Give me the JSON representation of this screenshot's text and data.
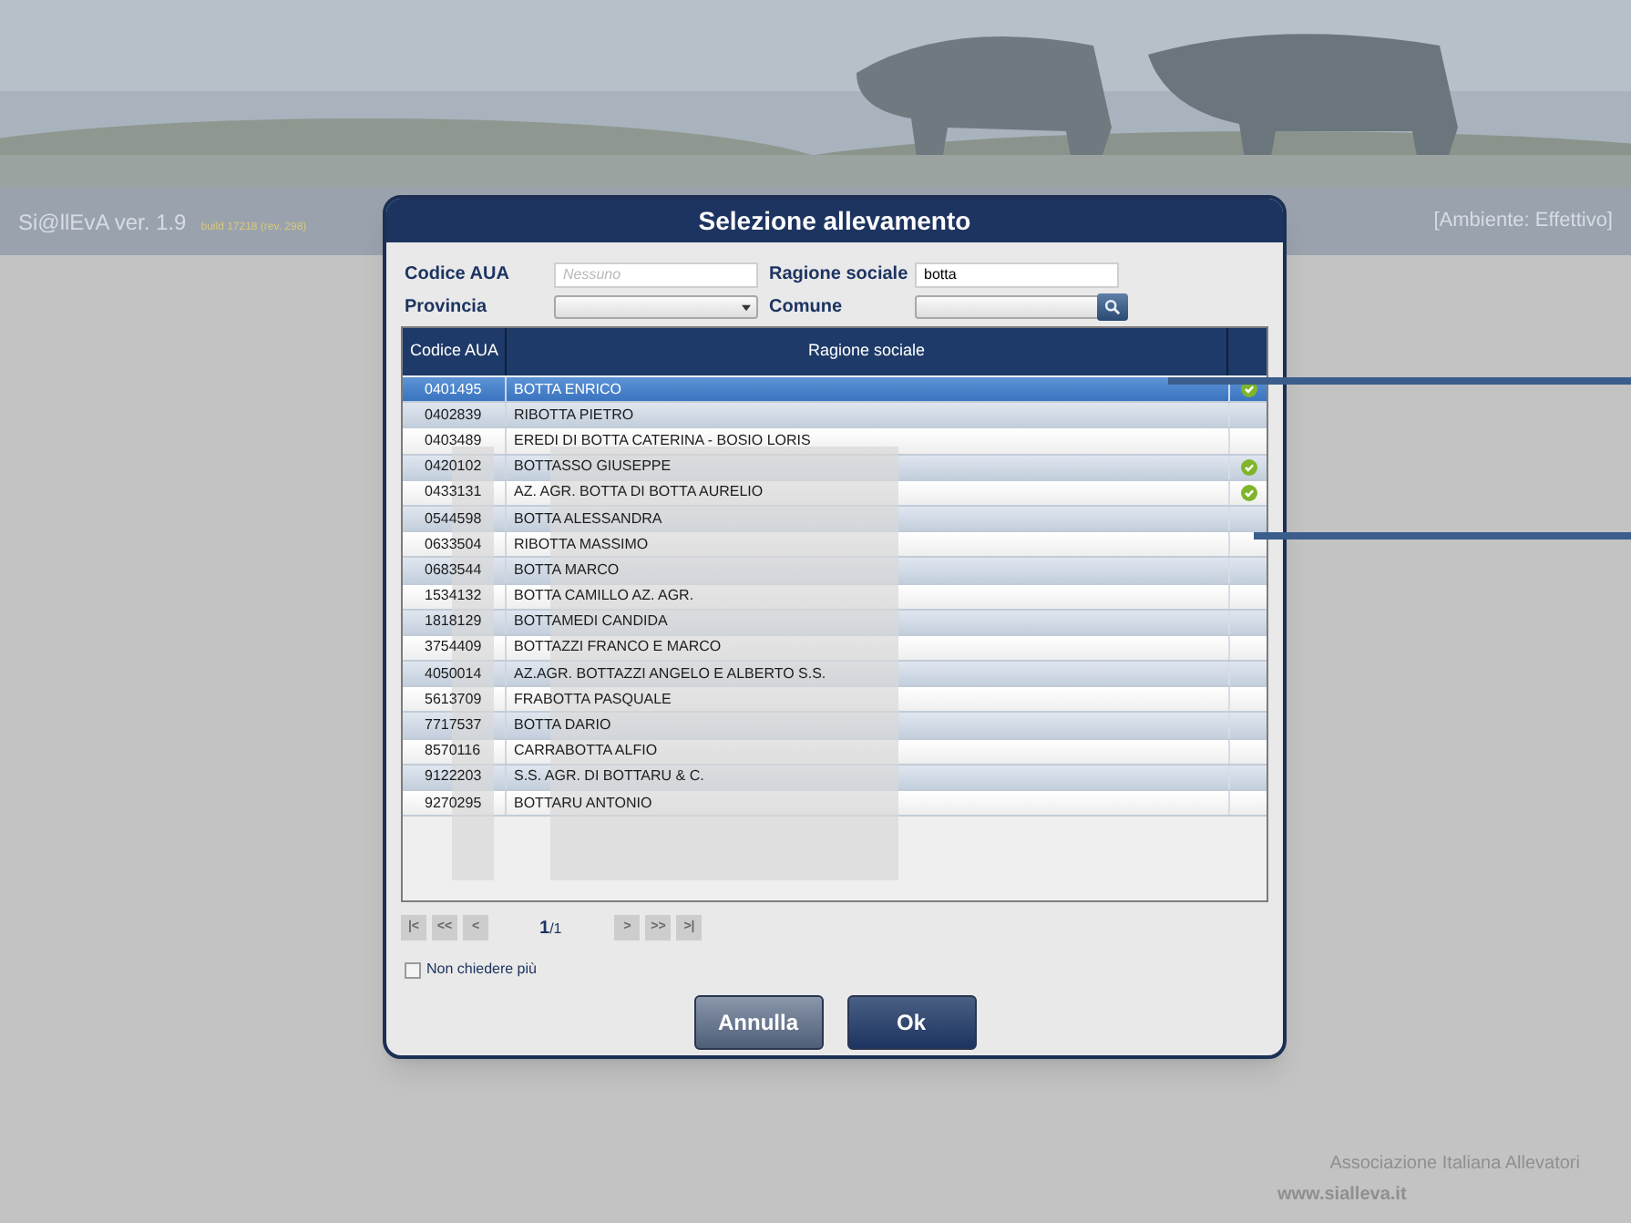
{
  "app": {
    "name": "Si@llEvA ver. 1.9",
    "build": "build 17218 (rev. 298)",
    "environment": "[Ambiente: Effettivo]"
  },
  "dialog": {
    "title": "Selezione allevamento",
    "filters": [
      {
        "label": "Codice AUA",
        "kind": "text",
        "placeholder": "Nessuno"
      },
      {
        "label": "Ragione sociale",
        "kind": "text",
        "value": "botta"
      },
      {
        "label": "Provincia",
        "kind": "select"
      },
      {
        "label": "Comune",
        "kind": "select"
      }
    ],
    "table": {
      "columns": [
        "Codice AUA",
        "Ragione sociale"
      ],
      "rows": [
        {
          "code": "0401495",
          "name": "BOTTA ENRICO",
          "selected": true,
          "verified": true
        },
        {
          "code": "0402839",
          "name": "RIBOTTA PIETRO",
          "selected": false,
          "verified": false
        },
        {
          "code": "0403489",
          "name": "EREDI DI BOTTA CATERINA - BOSIO LORIS",
          "selected": false,
          "verified": false
        },
        {
          "code": "0420102",
          "name": "BOTTASSO GIUSEPPE",
          "selected": false,
          "verified": true
        },
        {
          "code": "0433131",
          "name": "AZ. AGR. BOTTA DI BOTTA AURELIO",
          "selected": false,
          "verified": true
        },
        {
          "code": "0544598",
          "name": "BOTTA ALESSANDRA",
          "selected": false,
          "verified": false
        },
        {
          "code": "0633504",
          "name": "RIBOTTA MASSIMO",
          "selected": false,
          "verified": false
        },
        {
          "code": "0683544",
          "name": "BOTTA MARCO",
          "selected": false,
          "verified": false
        },
        {
          "code": "1534132",
          "name": "BOTTA CAMILLO AZ. AGR.",
          "selected": false,
          "verified": false
        },
        {
          "code": "1818129",
          "name": "BOTTAMEDI CANDIDA",
          "selected": false,
          "verified": false
        },
        {
          "code": "3754409",
          "name": "BOTTAZZI FRANCO E MARCO",
          "selected": false,
          "verified": false
        },
        {
          "code": "4050014",
          "name": "AZ.AGR. BOTTAZZI ANGELO E ALBERTO S.S.",
          "selected": false,
          "verified": false
        },
        {
          "code": "5613709",
          "name": "FRABOTTA PASQUALE",
          "selected": false,
          "verified": false
        },
        {
          "code": "7717537",
          "name": "BOTTA DARIO",
          "selected": false,
          "verified": false
        },
        {
          "code": "8570116",
          "name": "CARRABOTTA ALFIO",
          "selected": false,
          "verified": false
        },
        {
          "code": "9122203",
          "name": "S.S. AGR. DI BOTTARU & C.",
          "selected": false,
          "verified": false
        },
        {
          "code": "9270295",
          "name": "BOTTARU ANTONIO",
          "selected": false,
          "verified": false
        }
      ]
    },
    "pager": {
      "first": "|<",
      "prev_page": "<<",
      "prev": "<",
      "page": "1",
      "total": "/1",
      "next": ">",
      "next_page": ">>",
      "last": ">|"
    },
    "dont_ask": {
      "label": "Non chiedere più",
      "checked": false
    },
    "buttons": [
      "Annulla",
      "Ok"
    ]
  },
  "footer": {
    "association": "Associazione Italiana Allevatori",
    "website": "www.sialleva.it"
  }
}
